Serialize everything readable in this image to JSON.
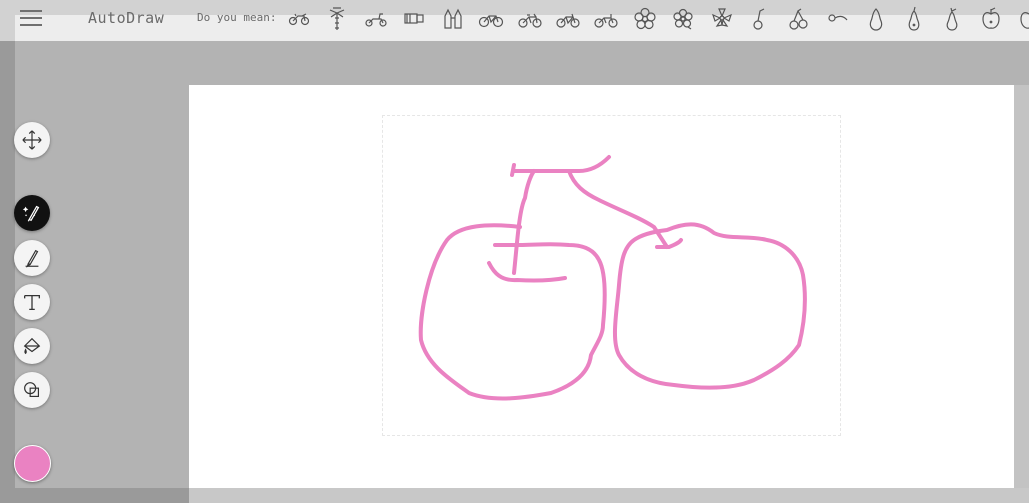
{
  "app": {
    "title": "AutoDraw"
  },
  "suggestions": {
    "label": "Do you mean:",
    "items": [
      {
        "name": "motorcycle-icon"
      },
      {
        "name": "palm-tree-icon"
      },
      {
        "name": "scooter-icon"
      },
      {
        "name": "film-roll-icon"
      },
      {
        "name": "binoculars-icon"
      },
      {
        "name": "bicycle-icon"
      },
      {
        "name": "bicycle-icon"
      },
      {
        "name": "bicycle-icon"
      },
      {
        "name": "bicycle-icon"
      },
      {
        "name": "flower-icon"
      },
      {
        "name": "flower-icon"
      },
      {
        "name": "flower-icon"
      },
      {
        "name": "cherry-icon"
      },
      {
        "name": "cherries-icon"
      },
      {
        "name": "cherry-icon"
      },
      {
        "name": "pear-icon"
      },
      {
        "name": "pear-icon"
      },
      {
        "name": "pear-icon"
      },
      {
        "name": "apple-icon"
      },
      {
        "name": "apple-icon"
      }
    ]
  },
  "tools": [
    {
      "name": "move-tool",
      "icon": "move-arrows-icon"
    },
    {
      "name": "autodraw-tool",
      "icon": "magic-pen-icon",
      "active": true
    },
    {
      "name": "draw-tool",
      "icon": "pen-icon"
    },
    {
      "name": "type-tool",
      "icon": "text-icon"
    },
    {
      "name": "fill-tool",
      "icon": "paint-bucket-icon"
    },
    {
      "name": "shape-tool",
      "icon": "shapes-icon"
    }
  ],
  "colors": {
    "stroke": "#ea82c2",
    "accent": "#111111",
    "canvas": "#ffffff"
  },
  "current_color": "#ea82c2"
}
